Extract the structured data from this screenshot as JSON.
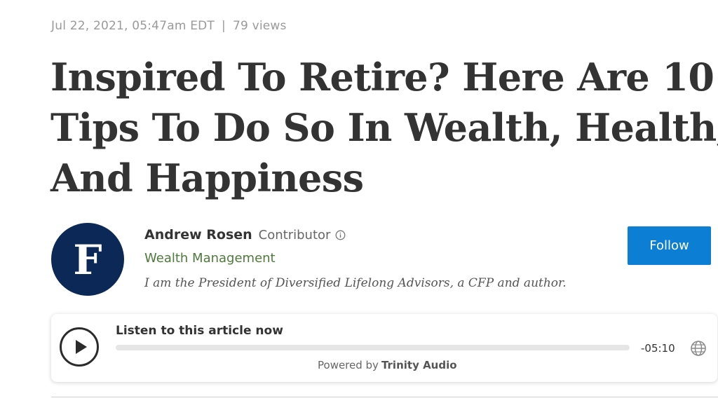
{
  "meta": {
    "date": "Jul 22, 2021, 05:47am EDT",
    "separator": "|",
    "views": "79 views"
  },
  "article": {
    "headline_line1": "Inspired To Retire? Here Are 10",
    "headline_line2": "Tips To Do So In Wealth, Health,",
    "headline_line3": "And Happiness"
  },
  "author": {
    "avatar_letter": "F",
    "name": "Andrew Rosen",
    "role": "Contributor",
    "channel": "Wealth Management",
    "bio": "I am the President of Diversified Lifelong Advisors, a CFP and author.",
    "follow_label": "Follow"
  },
  "audio_player": {
    "title": "Listen to this article now",
    "time_remaining": "-05:10",
    "progress": 0,
    "powered_by_prefix": "Powered by",
    "powered_by_brand": "Trinity Audio"
  },
  "colors": {
    "brand_navy": "#0c2857",
    "follow_blue": "#0c7fd4",
    "channel_green": "#4c7a3a"
  },
  "icons": [
    "info-icon",
    "play-icon",
    "globe-icon"
  ]
}
